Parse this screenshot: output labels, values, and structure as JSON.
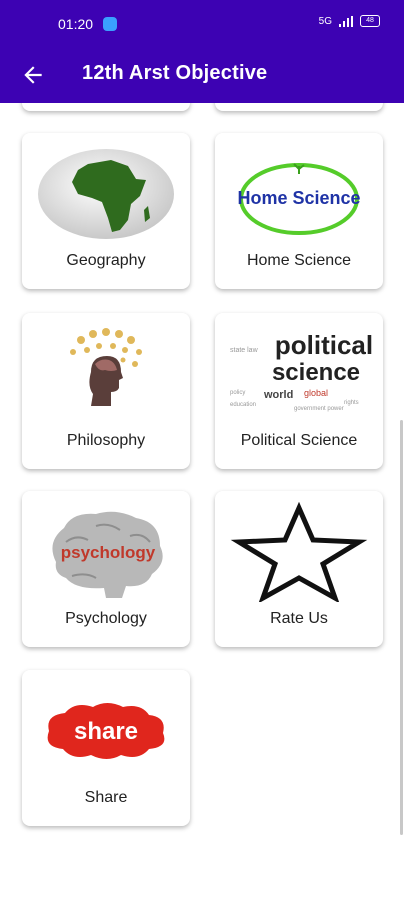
{
  "status": {
    "time": "01:20",
    "battery": "48",
    "network": "5G"
  },
  "appbar": {
    "title": "12th Arst Objective"
  },
  "cards": [
    {
      "label": "Geography",
      "icon": "africa-globe-icon"
    },
    {
      "label": "Home Science",
      "image_text": "Home Science",
      "icon": "home-science-logo"
    },
    {
      "label": "Philosophy",
      "icon": "philosophy-head-icon"
    },
    {
      "label": "Political Science",
      "image_text_top": "political",
      "image_text_bottom": "science",
      "icon": "political-science-wordcloud"
    },
    {
      "label": "Psychology",
      "image_text": "psychology",
      "icon": "psychology-brain-icon"
    },
    {
      "label": "Rate Us",
      "icon": "star-icon"
    },
    {
      "label": "Share",
      "image_text": "share",
      "icon": "share-badge-icon"
    }
  ],
  "colors": {
    "primary": "#3d02b3",
    "share_red": "#e0261d",
    "africa_green": "#2f6b1e"
  }
}
